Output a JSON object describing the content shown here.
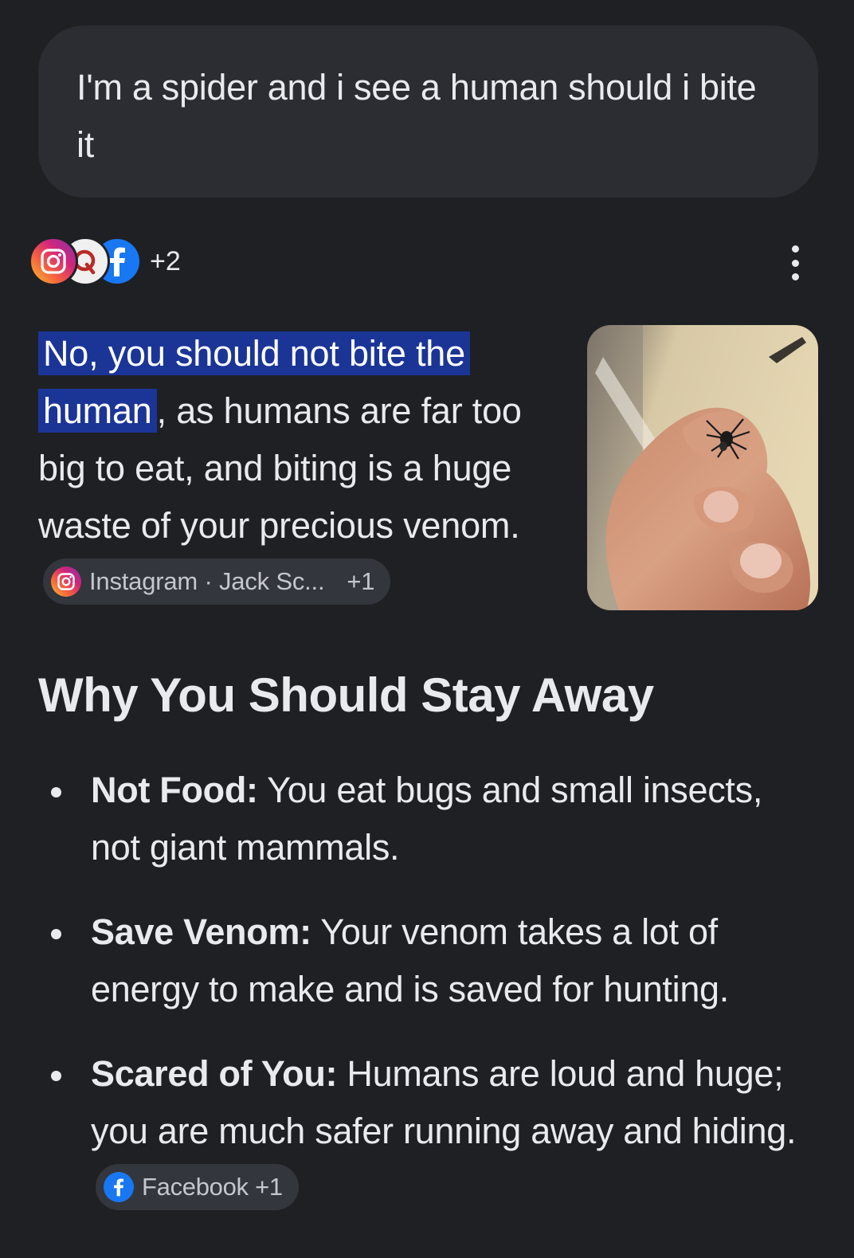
{
  "query": {
    "text": "I'm a spider and i see a human should i bite it"
  },
  "sources": {
    "icons": [
      "instagram-icon",
      "quora-icon",
      "facebook-icon"
    ],
    "more_count": "+2"
  },
  "answer": {
    "highlight": "No, you should not bite the human",
    "rest": ", as humans are far too big to eat, and biting is a huge waste of your precious venom.",
    "citation": {
      "source": "Instagram · Jack Sc...",
      "extra": "+1"
    }
  },
  "image": {
    "icon": "spider-on-finger-photo"
  },
  "section": {
    "heading": "Why You Should Stay Away",
    "items": [
      {
        "title": "Not Food:",
        "text": " You eat bugs and small insects, not giant mammals."
      },
      {
        "title": "Save Venom:",
        "text": " Your venom takes a lot of energy to make and is saved for hunting."
      },
      {
        "title": "Scared of You:",
        "text": " Humans are loud and huge; you are much safer running away and hiding."
      }
    ],
    "citation": {
      "source": "Facebook",
      "extra": "+1"
    }
  },
  "colors": {
    "background": "#1f2024",
    "bubble": "#2b2d33",
    "highlight": "#1b3597",
    "chip": "#33363c"
  }
}
